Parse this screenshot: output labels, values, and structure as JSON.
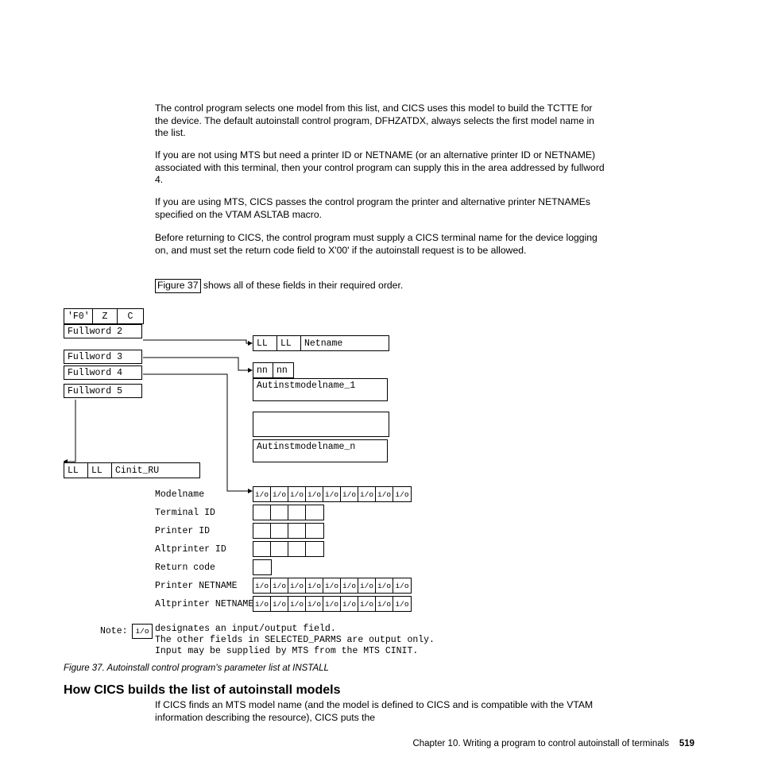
{
  "para1": "The control program selects one model from this list, and CICS uses this model to build the TCTTE for the device. The default autoinstall control program, DFHZATDX, always selects the first model name in the list.",
  "para2": "If you are not using MTS but need a printer ID or NETNAME (or an alternative printer ID or NETNAME) associated with this terminal, then your control program can supply this in the area addressed by fullword 4.",
  "para3": "If you are using MTS, CICS passes the control program the printer and alternative printer NETNAMEs specified on the VTAM ASLTAB macro.",
  "para4": "Before returning to CICS, the control program must supply a CICS terminal name for the device logging on, and must set the return code field to X'00' if the autoinstall request is to be allowed.",
  "figref": "Figure 37",
  "para5_rest": " shows all of these fields in their required order.",
  "fw1a": "'F0'",
  "fw1b": "Z",
  "fw1c": "C",
  "fw2": "Fullword 2",
  "fw3": "Fullword 3",
  "fw4": "Fullword 4",
  "fw5": "Fullword 5",
  "LL": "LL",
  "nn": "nn",
  "netname": "Netname",
  "cinit": "Cinit_RU",
  "aim1": "Autinstmodelname_1",
  "aimn": "Autinstmodelname_n",
  "lbl_modelname": "Modelname",
  "lbl_terminalid": "Terminal ID",
  "lbl_printerid": "Printer ID",
  "lbl_altprinterid": "Altprinter ID",
  "lbl_retcode": "Return code",
  "lbl_printernet": "Printer NETNAME",
  "lbl_altprinternet": "Altprinter NETNAME",
  "io": "i/o",
  "note": "Note:",
  "note_line1": "designates an input/output field.",
  "note_line2": "The other fields in SELECTED_PARMS are output only.",
  "note_line3": "Input may be supplied by MTS from the MTS CINIT.",
  "caption": "Figure 37. Autoinstall control program's parameter list at INSTALL",
  "h2": "How CICS builds the list of autoinstall models",
  "para_after_h2": "If CICS finds an MTS model name (and the model is defined to CICS and is compatible with the VTAM information describing the resource), CICS puts the",
  "footer_chap": "Chapter 10. Writing a program to control autoinstall of terminals",
  "footer_page": "519"
}
